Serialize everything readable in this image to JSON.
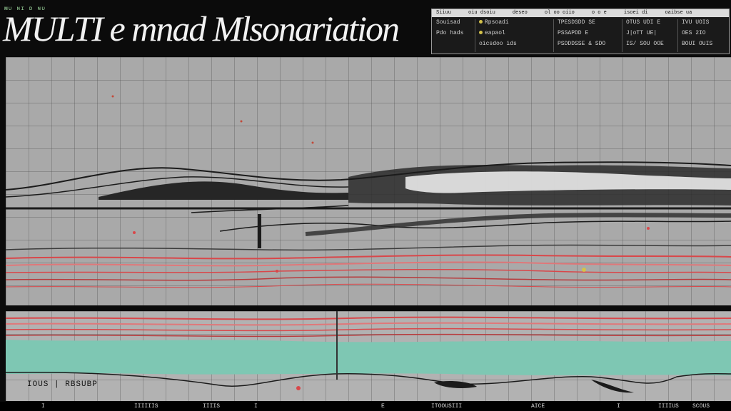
{
  "header": {
    "status_text": "ᴍᴜ ɴɪ ᴅ ɴᴜ",
    "title": "MULTI e mnad Mlsonariation"
  },
  "info_panel": {
    "header_items": [
      "Siiuu",
      "oiu dsoiu",
      "deseo",
      "ol oo oiio",
      "o o e",
      "isoei di",
      "oaibse ua"
    ],
    "col1": [
      "Souisad",
      "Pdo hads"
    ],
    "col2": [
      "Rpsoadi",
      "eapaol",
      "oicsdoo ids"
    ],
    "col3": [
      "TPESDSDD SE",
      "PSSAPDD E",
      "PSDDDSSE & SDO"
    ],
    "col4": [
      "OTUS UDI E",
      "J|oTT UE|",
      "IS/ SOU OOE"
    ],
    "col5": [
      "IVU UOIS",
      "OES 2IO",
      "BOUI OUIS"
    ]
  },
  "lower_panel": {
    "label": "IOUS | RBSUBP"
  },
  "footer": {
    "items": [
      "I",
      "IIIIIIS",
      "IIIIS",
      "I",
      "E",
      "ITOOUSIII",
      "AICE",
      "I",
      "IIIIUS",
      "SCOUS"
    ]
  },
  "colors": {
    "background": "#0b0b0b",
    "grid_panel": "#a9a9a9",
    "trace_red": "#d9474a",
    "trace_black": "#1b1b1b",
    "fill_teal": "#7ec7b3"
  }
}
